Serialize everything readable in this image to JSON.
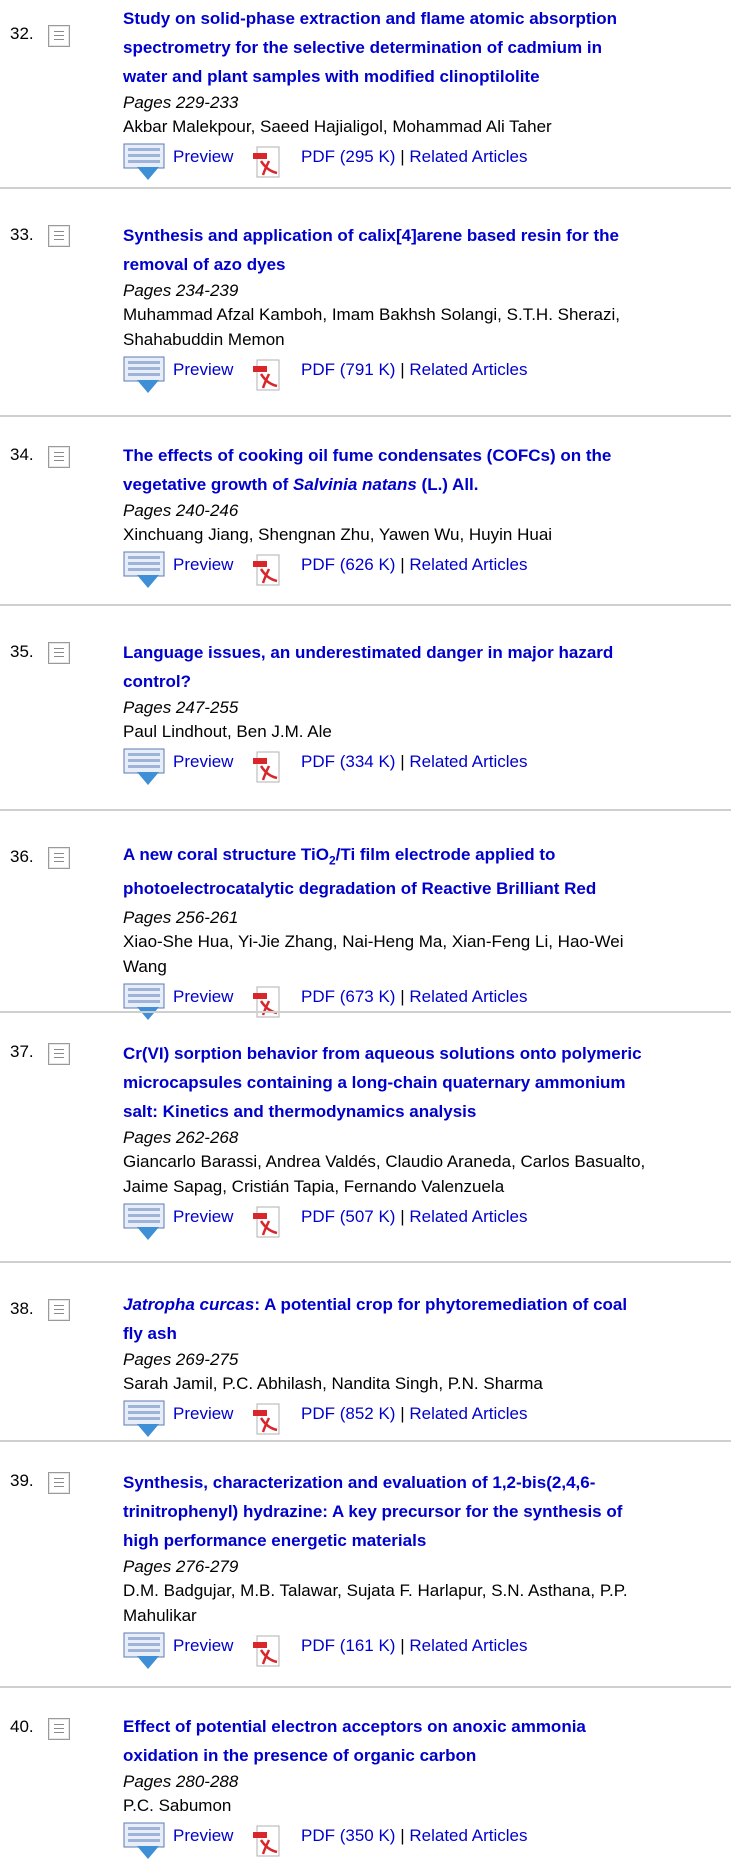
{
  "link_labels": {
    "preview": "Preview",
    "separator": "|",
    "related": "Related Articles"
  },
  "articles": [
    {
      "number": "32.",
      "title_lines": [
        "Study on solid-phase extraction and flame atomic absorption",
        "spectrometry for the selective determination of cadmium in",
        "water and plant samples with modified clinoptilolite"
      ],
      "pages": "Pages 229-233",
      "author_lines": [
        "Akbar Malekpour, Saeed Hajialigol, Mohammad Ali Taher"
      ],
      "pdf": "PDF (295 K)"
    },
    {
      "number": "33.",
      "title_lines": [
        "Synthesis and application of calix[4]arene based resin for the",
        "removal of azo dyes"
      ],
      "pages": "Pages 234-239",
      "author_lines": [
        "Muhammad Afzal Kamboh, Imam Bakhsh Solangi, S.T.H. Sherazi,",
        "Shahabuddin Memon"
      ],
      "pdf": "PDF (791 K)"
    },
    {
      "number": "34.",
      "title_lines": [
        "The effects of cooking oil fume condensates (COFCs) on the"
      ],
      "title_line2": {
        "before": "vegetative growth of ",
        "italic": "Salvinia natans",
        "after": " (L.) All."
      },
      "pages": "Pages 240-246",
      "author_lines": [
        "Xinchuang Jiang, Shengnan Zhu, Yawen Wu, Huyin Huai"
      ],
      "pdf": "PDF (626 K)"
    },
    {
      "number": "35.",
      "title_lines": [
        "Language issues, an underestimated danger in major hazard",
        "control?"
      ],
      "pages": "Pages 247-255",
      "author_lines": [
        "Paul Lindhout, Ben J.M. Ale"
      ],
      "pdf": "PDF (334 K)"
    },
    {
      "number": "36.",
      "title_line1": {
        "before": "A new coral structure TiO",
        "sub": "2",
        "after": "/Ti film electrode applied to"
      },
      "title_lines": [
        "photoelectrocatalytic degradation of Reactive Brilliant Red"
      ],
      "pages": "Pages 256-261",
      "author_lines": [
        "Xiao-She Hua, Yi-Jie Zhang, Nai-Heng Ma, Xian-Feng Li, Hao-Wei",
        "Wang"
      ],
      "pdf": "PDF (673 K)"
    },
    {
      "number": "37.",
      "title_lines": [
        "Cr(VI) sorption behavior from aqueous solutions onto polymeric",
        "microcapsules containing a long-chain quaternary ammonium",
        "salt: Kinetics and thermodynamics analysis"
      ],
      "pages": "Pages 262-268",
      "author_lines": [
        "Giancarlo Barassi, Andrea Valdés, Claudio Araneda, Carlos Basualto,",
        "Jaime Sapag, Cristián Tapia, Fernando Valenzuela"
      ],
      "pdf": "PDF (507 K)"
    },
    {
      "number": "38.",
      "title_line1": {
        "italic": "Jatropha curcas",
        "after": ": A potential crop for phytoremediation of coal"
      },
      "title_lines": [
        "fly ash"
      ],
      "pages": "Pages 269-275",
      "author_lines": [
        "Sarah Jamil, P.C. Abhilash, Nandita Singh, P.N. Sharma"
      ],
      "pdf": "PDF (852 K)"
    },
    {
      "number": "39.",
      "title_lines": [
        "Synthesis, characterization and evaluation of 1,2-bis(2,4,6-",
        "trinitrophenyl) hydrazine: A key precursor for the synthesis of",
        "high performance energetic materials"
      ],
      "pages": "Pages 276-279",
      "author_lines": [
        "D.M. Badgujar, M.B. Talawar, Sujata F. Harlapur, S.N. Asthana, P.P.",
        "Mahulikar"
      ],
      "pdf": "PDF (161 K)"
    },
    {
      "number": "40.",
      "title_lines": [
        "Effect of potential electron acceptors on anoxic ammonia",
        "oxidation in the presence of organic carbon"
      ],
      "pages": "Pages 280-288",
      "author_lines": [
        "P.C. Sabumon"
      ],
      "pdf": "PDF (350 K)"
    }
  ]
}
